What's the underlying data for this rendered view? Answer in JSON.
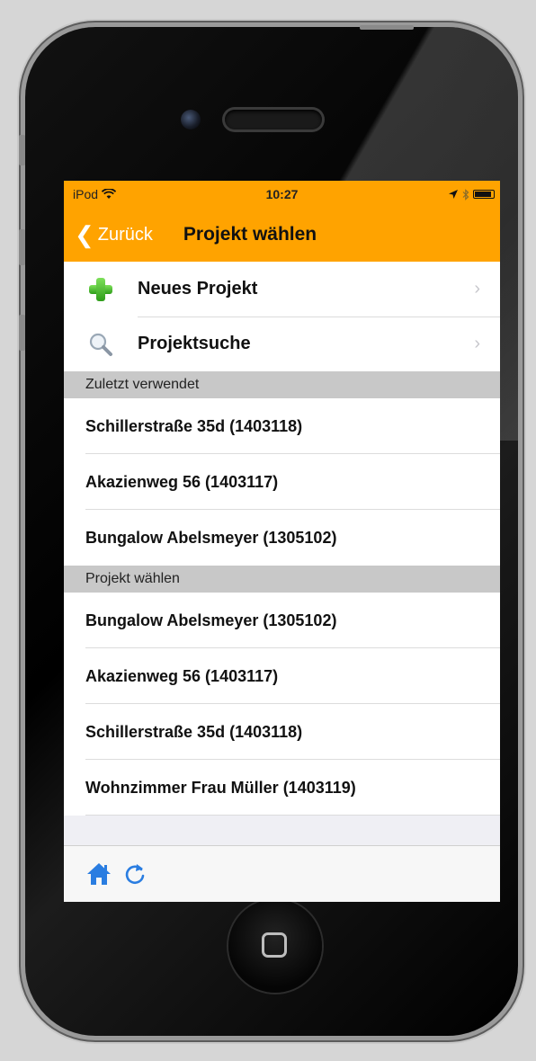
{
  "status_bar": {
    "carrier": "iPod",
    "time": "10:27"
  },
  "nav": {
    "back_label": "Zurück",
    "title": "Projekt wählen"
  },
  "menu": [
    {
      "label": "Neues Projekt",
      "icon": "green-plus-icon"
    },
    {
      "label": "Projektsuche",
      "icon": "magnifier-icon"
    }
  ],
  "sections": [
    {
      "header": "Zuletzt verwendet",
      "items": [
        "Schillerstraße 35d (1403118)",
        "Akazienweg 56 (1403117)",
        "Bungalow Abelsmeyer (1305102)"
      ]
    },
    {
      "header": "Projekt wählen",
      "items": [
        "Bungalow Abelsmeyer (1305102)",
        "Akazienweg 56 (1403117)",
        "Schillerstraße 35d (1403118)",
        "Wohnzimmer Frau Müller (1403119)"
      ]
    }
  ],
  "toolbar": {
    "icons": [
      "home-icon",
      "refresh-icon"
    ]
  },
  "colors": {
    "accent": "#ffa300",
    "toolbar_icon": "#2a7de1",
    "section_bg": "#c8c8c8"
  }
}
